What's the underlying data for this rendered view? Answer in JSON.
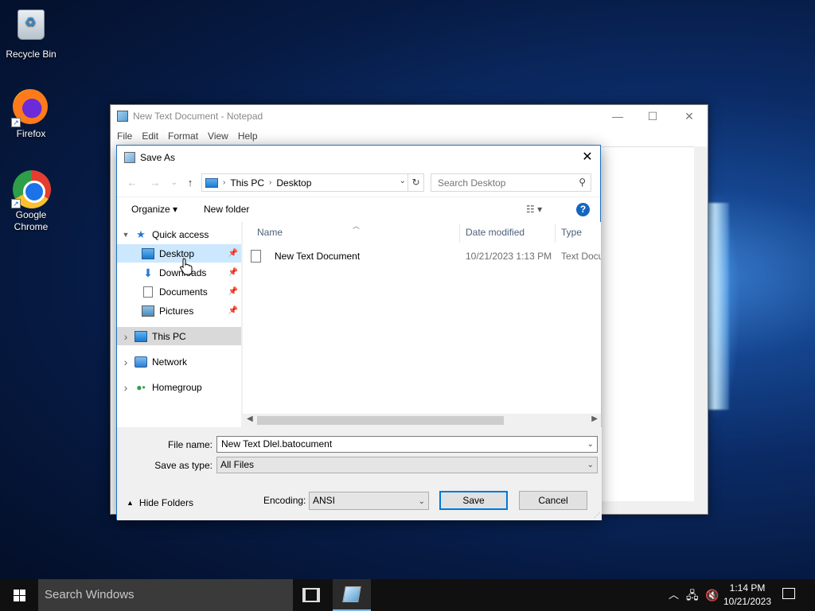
{
  "desktop": {
    "icons": [
      {
        "label": "Recycle Bin"
      },
      {
        "label": "Firefox"
      },
      {
        "label": "Google Chrome"
      }
    ]
  },
  "notepad": {
    "title": "New Text Document - Notepad",
    "menu": [
      "File",
      "Edit",
      "Format",
      "View",
      "Help"
    ],
    "minimize": "—",
    "maximize": "☐",
    "close": "✕"
  },
  "dialog": {
    "title": "Save As",
    "close": "✕",
    "nav": {
      "back": "←",
      "forward": "→",
      "recent": "⌄",
      "up": "↑"
    },
    "address": {
      "segments": [
        "This PC",
        "Desktop"
      ],
      "separator": "›"
    },
    "search": {
      "placeholder": "Search Desktop"
    },
    "toolbar": {
      "organize": "Organize ▾",
      "new_folder": "New folder",
      "view": "☷ ▾",
      "help": "?"
    },
    "tree": [
      {
        "label": "Quick access",
        "arrow": "▼"
      },
      {
        "label": "Desktop"
      },
      {
        "label": "Downloads"
      },
      {
        "label": "Documents"
      },
      {
        "label": "Pictures"
      },
      {
        "label": "This PC",
        "arrow": "›"
      },
      {
        "label": "Network",
        "arrow": "›"
      },
      {
        "label": "Homegroup",
        "arrow": "›"
      }
    ],
    "columns": [
      "Name",
      "Date modified",
      "Type"
    ],
    "files": [
      {
        "name": "New Text Document",
        "date": "10/21/2023 1:13 PM",
        "type": "Text Docu"
      }
    ],
    "form": {
      "filename_label": "File name:",
      "filename_value": "New Text Dlel.batocument",
      "savetype_label": "Save as type:",
      "savetype_value": "All Files",
      "hide_folders": "Hide Folders",
      "encoding_label": "Encoding:",
      "encoding_value": "ANSI",
      "save": "Save",
      "cancel": "Cancel"
    }
  },
  "taskbar": {
    "search_placeholder": "Search Windows",
    "time": "1:14 PM",
    "date": "10/21/2023"
  },
  "colors": {
    "accent": "#0078d7",
    "selection": "#cce8ff"
  }
}
